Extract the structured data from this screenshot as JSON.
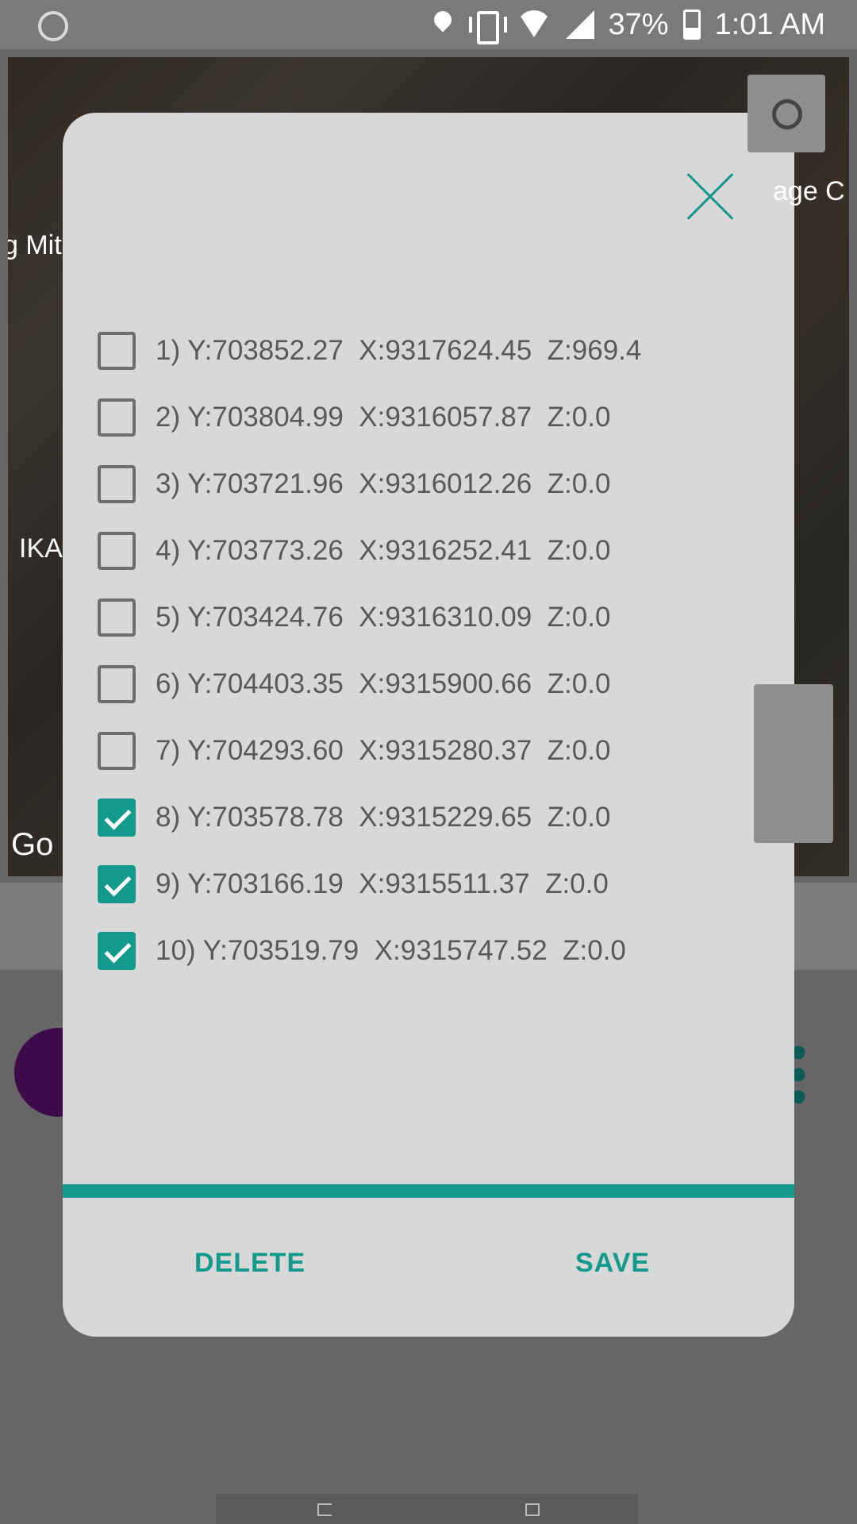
{
  "status_bar": {
    "battery_percent": "37%",
    "time": "1:01 AM",
    "icons": [
      "sync-icon",
      "location-icon",
      "vibrate-icon",
      "wifi-icon",
      "signal-icon",
      "battery-icon"
    ]
  },
  "map": {
    "labels": [
      "g Mit",
      "IKA",
      "age C",
      "Go"
    ]
  },
  "dialog": {
    "points": [
      {
        "label": "1) Y:703852.27  X:9317624.45  Z:969.4",
        "checked": false
      },
      {
        "label": "2) Y:703804.99  X:9316057.87  Z:0.0",
        "checked": false
      },
      {
        "label": "3) Y:703721.96  X:9316012.26  Z:0.0",
        "checked": false
      },
      {
        "label": "4) Y:703773.26  X:9316252.41  Z:0.0",
        "checked": false
      },
      {
        "label": "5) Y:703424.76  X:9316310.09  Z:0.0",
        "checked": false
      },
      {
        "label": "6) Y:704403.35  X:9315900.66  Z:0.0",
        "checked": false
      },
      {
        "label": "7) Y:704293.60  X:9315280.37  Z:0.0",
        "checked": false
      },
      {
        "label": "8) Y:703578.78  X:9315229.65  Z:0.0",
        "checked": true
      },
      {
        "label": "9) Y:703166.19  X:9315511.37  Z:0.0",
        "checked": true
      },
      {
        "label": "10) Y:703519.79  X:9315747.52  Z:0.0",
        "checked": true
      }
    ],
    "delete_label": "DELETE",
    "save_label": "SAVE",
    "accent_color": "#139a8c"
  }
}
